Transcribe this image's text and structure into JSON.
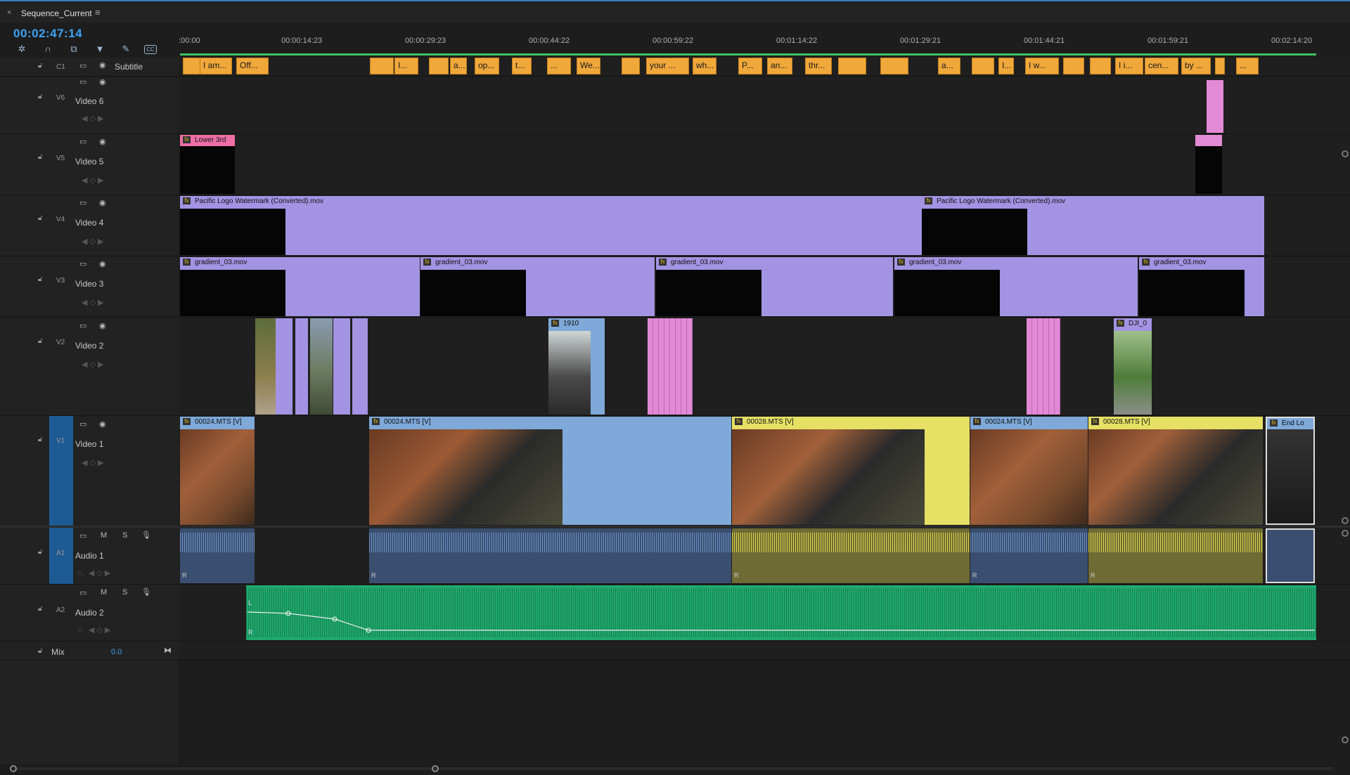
{
  "sequence": {
    "title": "Sequence_Current",
    "close": "×",
    "menu": "≡",
    "timecode": "00:02:47:14"
  },
  "tools": [
    "snap-icon",
    "magnet-icon",
    "linked-selection-icon",
    "marker-icon",
    "wrench-icon",
    "captions-icon"
  ],
  "ruler": {
    "labels": [
      ":00:00",
      "00:00:14:23",
      "00:00:29:23",
      "00:00:44:22",
      "00:00:59:22",
      "00:01:14:22",
      "00:01:29:21",
      "00:01:44:21",
      "00:01:59:21",
      "00:02:14:20"
    ]
  },
  "tracks": {
    "c1": {
      "id": "C1",
      "name": "Subtitle"
    },
    "v6": {
      "id": "V6",
      "name": "Video 6"
    },
    "v5": {
      "id": "V5",
      "name": "Video 5"
    },
    "v4": {
      "id": "V4",
      "name": "Video 4"
    },
    "v3": {
      "id": "V3",
      "name": "Video 3"
    },
    "v2": {
      "id": "V2",
      "name": "Video 2"
    },
    "v1": {
      "id": "V1",
      "name": "Video 1"
    },
    "a1": {
      "id": "A1",
      "name": "Audio 1",
      "m": "M",
      "s": "S"
    },
    "a2": {
      "id": "A2",
      "name": "Audio 2",
      "m": "M",
      "s": "S"
    },
    "mix": {
      "name": "Mix",
      "value": "0.0"
    }
  },
  "subtitles": [
    "I am...",
    "Off...",
    "",
    "I...",
    "",
    "a...",
    "op...",
    "t...",
    "...",
    "We...",
    "",
    "your ...",
    "wh...",
    "P...",
    "an...",
    "thr...",
    "",
    "",
    "a...",
    "",
    "I...",
    "I w...",
    "",
    "",
    "I i...",
    "cen...",
    "by ...",
    "",
    "..."
  ],
  "clips": {
    "lower3rd": "Lower 3rd",
    "watermark1": "Pacific Logo Watermark (Converted).mov",
    "watermark2": "Pacific Logo Watermark (Converted).mov",
    "gradient": "gradient_03.mov",
    "v2_1910": "1910",
    "v2_dji": "DJI_0",
    "v1_a": "00024.MTS [V]",
    "v1_b": "00024.MTS [V]",
    "v1_c": "00028.MTS [V]",
    "v1_d": "00024.MTS [V]",
    "v1_e": "00028.MTS [V]",
    "v1_end": "End Lo",
    "fx": "fx",
    "r": "R",
    "l": "L"
  },
  "colors": {
    "accent": "#3ea3f5",
    "subtitle": "#f0a83b",
    "purple": "#a393e3",
    "pink": "#e38ad7",
    "video_blue": "#7ea9d9",
    "video_yellow": "#e6e064",
    "audio_green": "#1fa96f"
  }
}
